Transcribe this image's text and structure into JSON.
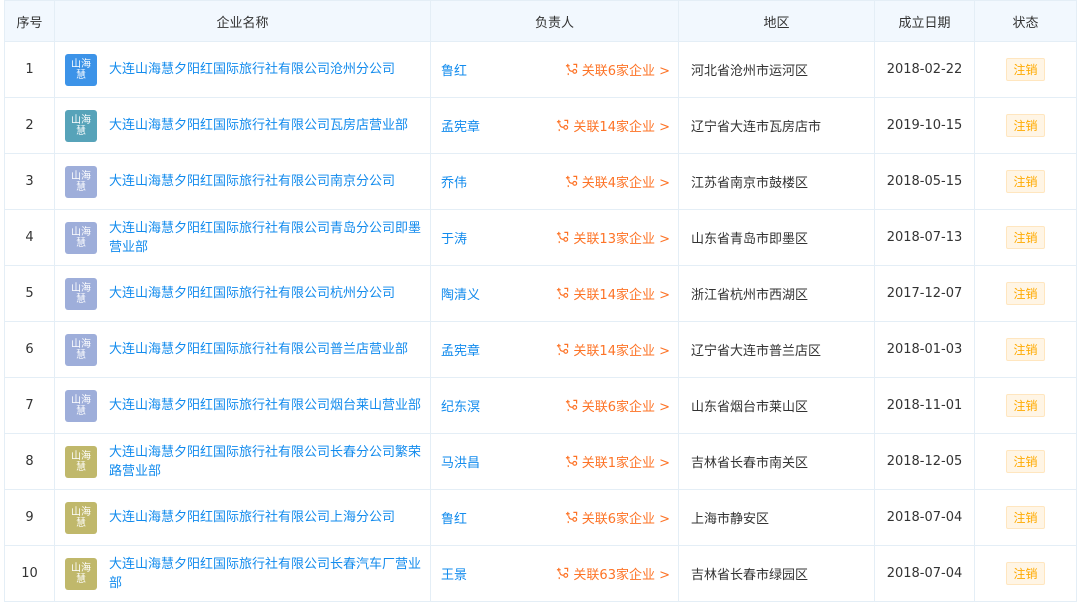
{
  "colors": {
    "link": "#128bed",
    "relation": "#fd7326",
    "status": "#ffaa00",
    "logo_blue": "#3c93e8",
    "logo_teal": "#57a3b9",
    "logo_lavender": "#9eaeda",
    "logo_olive": "#c0b86b"
  },
  "headers": {
    "index": "序号",
    "company": "企业名称",
    "person": "负责人",
    "region": "地区",
    "date": "成立日期",
    "status": "状态"
  },
  "rows": [
    {
      "index": "1",
      "logo_top": "山海",
      "logo_bottom": "慧",
      "logo_color": "#3c93e8",
      "company": "大连山海慧夕阳红国际旅行社有限公司沧州分公司",
      "person": "鲁红",
      "relation": "关联6家企业 >",
      "region": "河北省沧州市运河区",
      "date": "2018-02-22",
      "status": "注销"
    },
    {
      "index": "2",
      "logo_top": "山海",
      "logo_bottom": "慧",
      "logo_color": "#57a3b9",
      "company": "大连山海慧夕阳红国际旅行社有限公司瓦房店营业部",
      "person": "孟宪章",
      "relation": "关联14家企业 >",
      "region": "辽宁省大连市瓦房店市",
      "date": "2019-10-15",
      "status": "注销"
    },
    {
      "index": "3",
      "logo_top": "山海",
      "logo_bottom": "慧",
      "logo_color": "#9eaeda",
      "company": "大连山海慧夕阳红国际旅行社有限公司南京分公司",
      "person": "乔伟",
      "relation": "关联4家企业 >",
      "region": "江苏省南京市鼓楼区",
      "date": "2018-05-15",
      "status": "注销"
    },
    {
      "index": "4",
      "logo_top": "山海",
      "logo_bottom": "慧",
      "logo_color": "#9eaeda",
      "company": "大连山海慧夕阳红国际旅行社有限公司青岛分公司即墨营业部",
      "person": "于涛",
      "relation": "关联13家企业 >",
      "region": "山东省青岛市即墨区",
      "date": "2018-07-13",
      "status": "注销"
    },
    {
      "index": "5",
      "logo_top": "山海",
      "logo_bottom": "慧",
      "logo_color": "#9eaeda",
      "company": "大连山海慧夕阳红国际旅行社有限公司杭州分公司",
      "person": "陶清义",
      "relation": "关联14家企业 >",
      "region": "浙江省杭州市西湖区",
      "date": "2017-12-07",
      "status": "注销"
    },
    {
      "index": "6",
      "logo_top": "山海",
      "logo_bottom": "慧",
      "logo_color": "#9eaeda",
      "company": "大连山海慧夕阳红国际旅行社有限公司普兰店营业部",
      "person": "孟宪章",
      "relation": "关联14家企业 >",
      "region": "辽宁省大连市普兰店区",
      "date": "2018-01-03",
      "status": "注销"
    },
    {
      "index": "7",
      "logo_top": "山海",
      "logo_bottom": "慧",
      "logo_color": "#9eaeda",
      "company": "大连山海慧夕阳红国际旅行社有限公司烟台莱山营业部",
      "person": "纪东溟",
      "relation": "关联6家企业 >",
      "region": "山东省烟台市莱山区",
      "date": "2018-11-01",
      "status": "注销"
    },
    {
      "index": "8",
      "logo_top": "山海",
      "logo_bottom": "慧",
      "logo_color": "#c0b86b",
      "company": "大连山海慧夕阳红国际旅行社有限公司长春分公司繁荣路营业部",
      "person": "马洪昌",
      "relation": "关联1家企业 >",
      "region": "吉林省长春市南关区",
      "date": "2018-12-05",
      "status": "注销"
    },
    {
      "index": "9",
      "logo_top": "山海",
      "logo_bottom": "慧",
      "logo_color": "#c0b86b",
      "company": "大连山海慧夕阳红国际旅行社有限公司上海分公司",
      "person": "鲁红",
      "relation": "关联6家企业 >",
      "region": "上海市静安区",
      "date": "2018-07-04",
      "status": "注销"
    },
    {
      "index": "10",
      "logo_top": "山海",
      "logo_bottom": "慧",
      "logo_color": "#c0b86b",
      "company": "大连山海慧夕阳红国际旅行社有限公司长春汽车厂营业部",
      "person": "王景",
      "relation": "关联63家企业 >",
      "region": "吉林省长春市绿园区",
      "date": "2018-07-04",
      "status": "注销"
    }
  ]
}
